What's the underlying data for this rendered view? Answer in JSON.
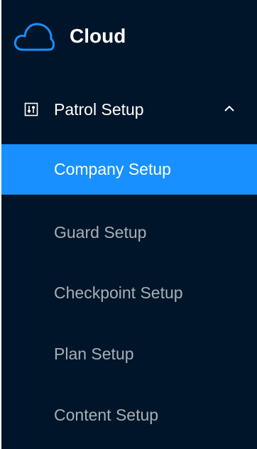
{
  "app": {
    "name": "Cloud",
    "logo_icon": "cloud-icon",
    "accent_color": "#1890ff",
    "sidebar_bg": "#001529"
  },
  "menu": {
    "submenu": {
      "icon": "settings-panel-icon",
      "label": "Patrol Setup",
      "expanded": true,
      "chevron_icon": "chevron-up-icon"
    },
    "items": [
      {
        "label": "Company Setup",
        "active": true
      },
      {
        "label": "Guard Setup",
        "active": false
      },
      {
        "label": "Checkpoint Setup",
        "active": false
      },
      {
        "label": "Plan Setup",
        "active": false
      },
      {
        "label": "Content Setup",
        "active": false
      }
    ]
  }
}
